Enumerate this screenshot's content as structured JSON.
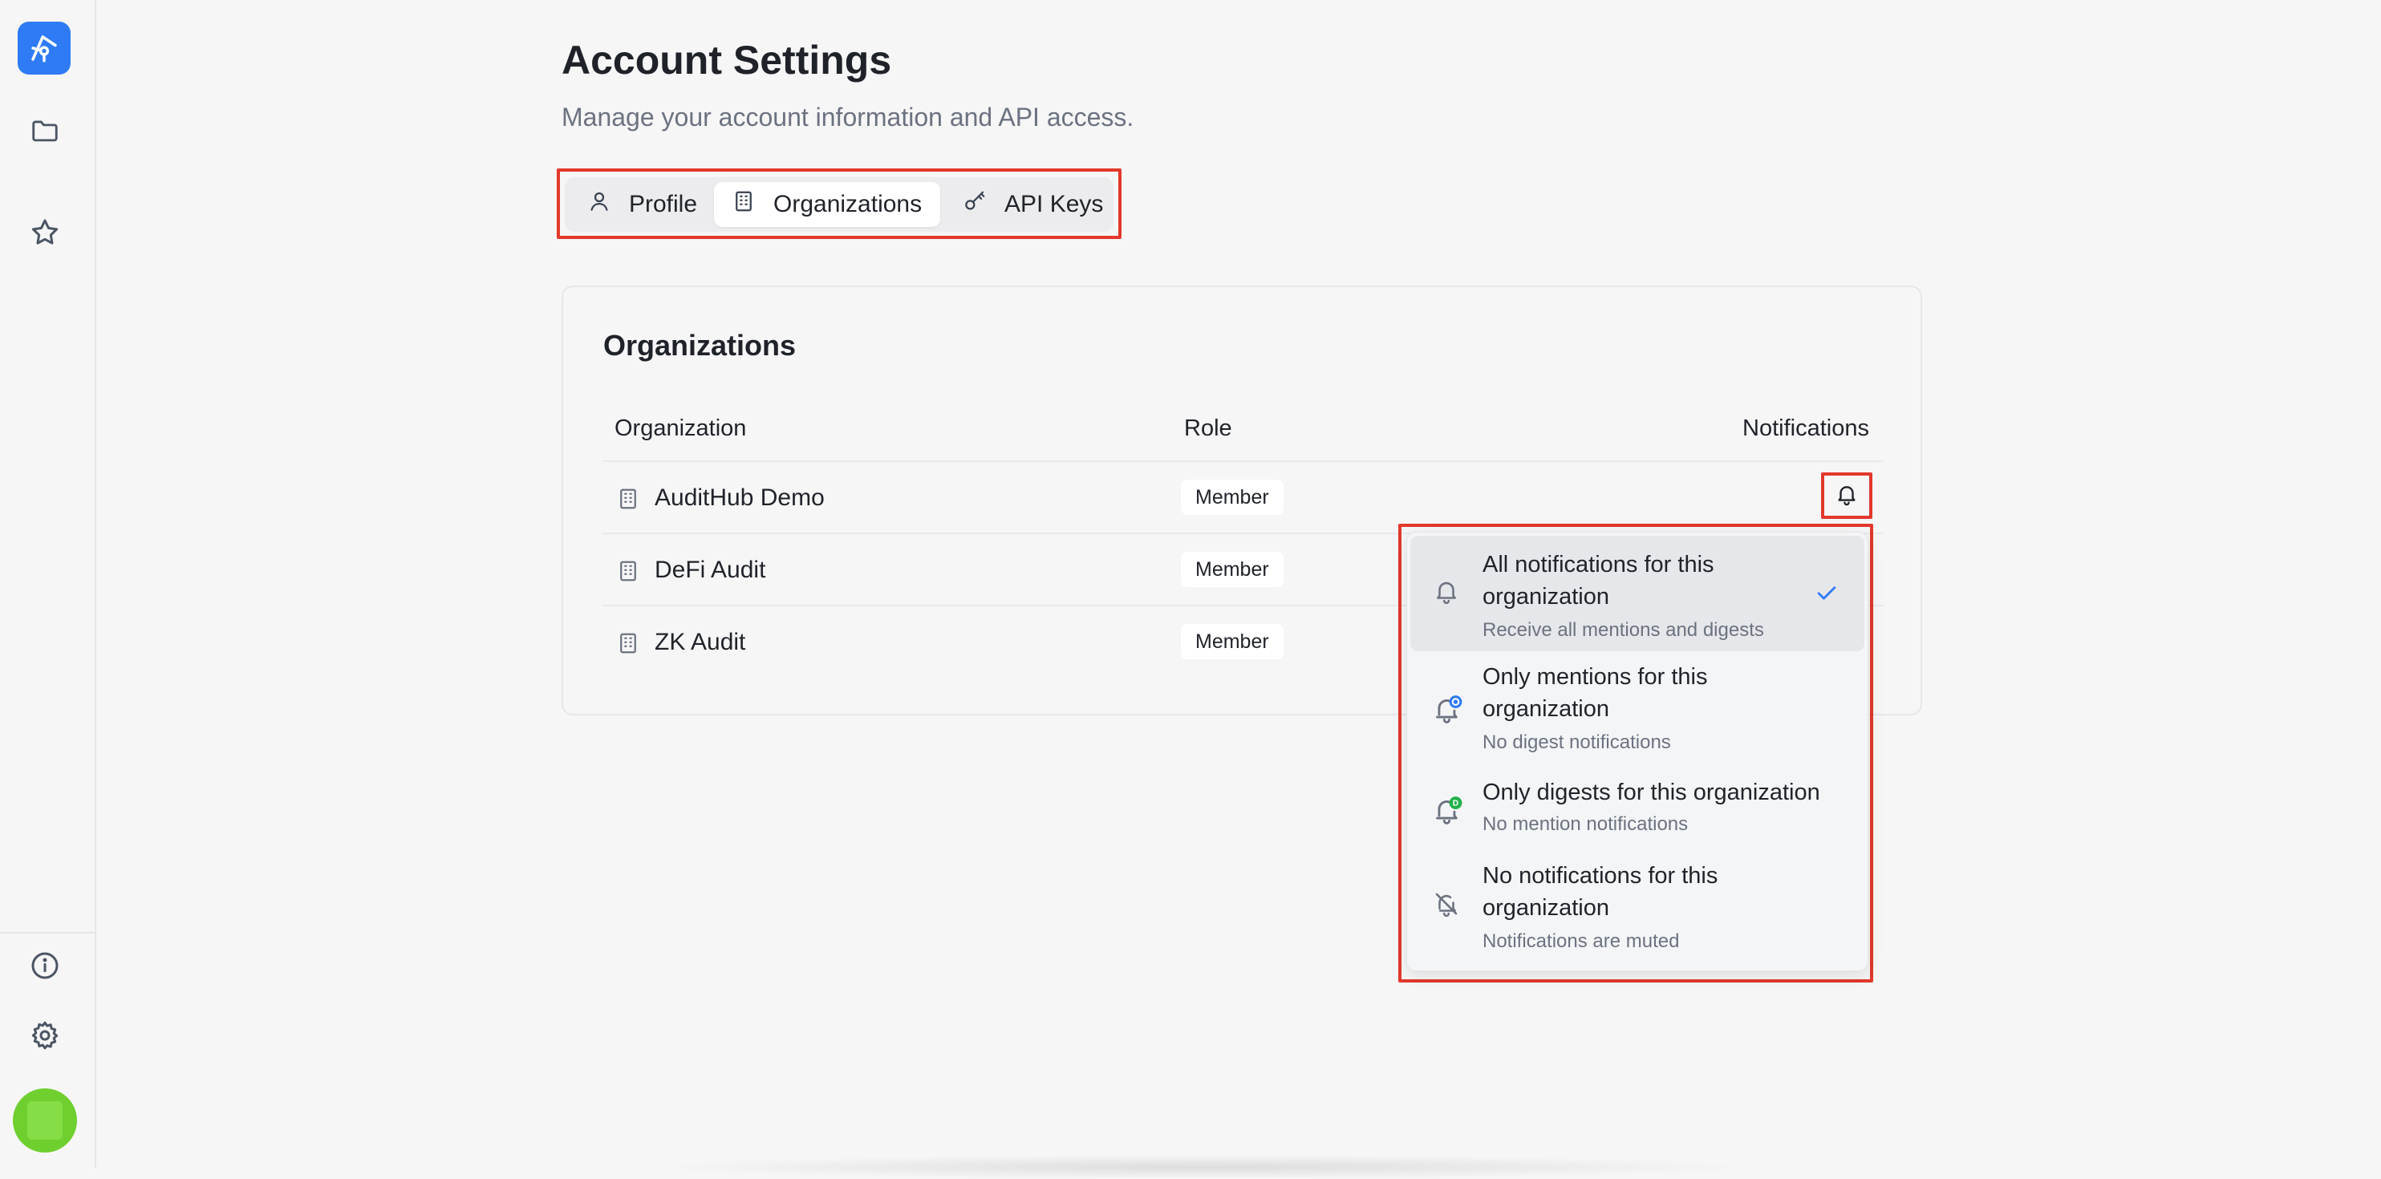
{
  "app": {
    "brand_color": "#2f7bf6",
    "highlight_color": "#e2382b"
  },
  "sidebar": {
    "items": [
      {
        "icon": "folder-icon"
      },
      {
        "icon": "star-icon"
      }
    ],
    "footer": [
      {
        "icon": "info-icon"
      },
      {
        "icon": "gear-icon"
      }
    ]
  },
  "header": {
    "title": "Account Settings",
    "subtitle": "Manage your account information and API access."
  },
  "tabs": [
    {
      "label": "Profile",
      "icon": "user-icon",
      "active": false
    },
    {
      "label": "Organizations",
      "icon": "building-icon",
      "active": true
    },
    {
      "label": "API Keys",
      "icon": "key-icon",
      "active": false
    }
  ],
  "organizations": {
    "title": "Organizations",
    "columns": [
      "Organization",
      "Role",
      "Notifications"
    ],
    "rows": [
      {
        "name": "AuditHub Demo",
        "role": "Member"
      },
      {
        "name": "DeFi Audit",
        "role": "Member"
      },
      {
        "name": "ZK Audit",
        "role": "Member"
      }
    ]
  },
  "notification_menu": {
    "items": [
      {
        "title": "All notifications for this organization",
        "subtitle": "Receive all mentions and digests",
        "icon": "bell-icon",
        "selected": true
      },
      {
        "title": "Only mentions for this organization",
        "subtitle": "No digest notifications",
        "icon": "bell-mention-icon",
        "selected": false
      },
      {
        "title": "Only digests for this organization",
        "subtitle": "No mention notifications",
        "icon": "bell-digest-icon",
        "selected": false
      },
      {
        "title": "No notifications for this organization",
        "subtitle": "Notifications are muted",
        "icon": "bell-off-icon",
        "selected": false
      }
    ]
  }
}
